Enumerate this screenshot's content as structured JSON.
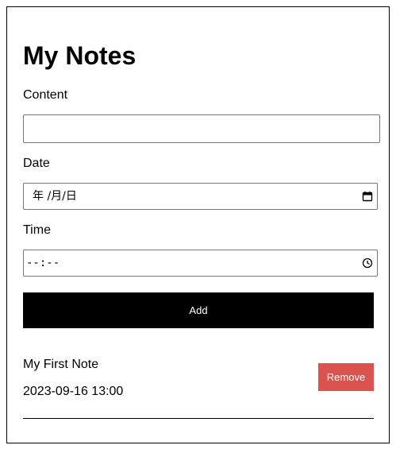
{
  "page": {
    "title": "My Notes"
  },
  "form": {
    "content": {
      "label": "Content",
      "value": "",
      "placeholder": ""
    },
    "date": {
      "label": "Date",
      "display": "年 /月/日",
      "icon": "calendar-icon"
    },
    "time": {
      "label": "Time",
      "display": "--:--",
      "icon": "clock-icon"
    },
    "add_label": "Add"
  },
  "notes": [
    {
      "title": "My First Note",
      "datetime": "2023-09-16 13:00",
      "remove_label": "Remove"
    }
  ],
  "colors": {
    "add_button": "#000000",
    "remove_button": "#d9534f",
    "border": "#000000"
  }
}
